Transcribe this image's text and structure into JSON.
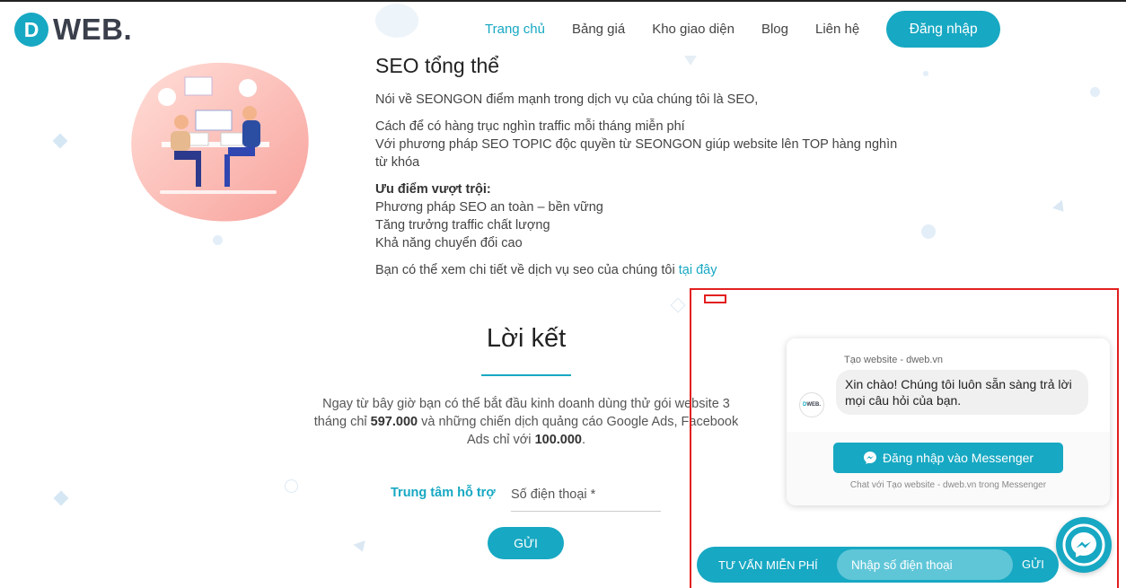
{
  "header": {
    "logo_letter": "D",
    "logo_text": "WEB.",
    "nav": [
      {
        "label": "Trang chủ",
        "active": true
      },
      {
        "label": "Bảng giá"
      },
      {
        "label": "Kho giao diện"
      },
      {
        "label": "Blog"
      },
      {
        "label": "Liên hệ"
      }
    ],
    "login_label": "Đăng nhập"
  },
  "seo": {
    "title": "SEO tổng thể",
    "intro": "Nói về SEONGON điểm mạnh trong dịch vụ của chúng tôi là SEO,",
    "line1": "Cách để có hàng trục nghìn traffic mỗi tháng miễn phí",
    "line2": "Với phương pháp SEO TOPIC độc quyền từ SEONGON giúp website lên TOP hàng nghìn từ khóa",
    "advantages_title": "Ưu điểm vượt trội:",
    "advantages": [
      "Phương pháp SEO an toàn – bền vững",
      "Tăng trưởng traffic chất lượng",
      "Khả năng chuyển đổi cao"
    ],
    "detail_text": "Bạn có thể xem chi tiết về dịch vụ seo của chúng tôi ",
    "detail_link": "tại đây"
  },
  "closing": {
    "title": "Lời kết",
    "text_a": "Ngay từ bây giờ bạn có thể bắt đầu kinh doanh dùng thử gói website 3 tháng chỉ ",
    "price1": "597.000",
    "text_b": " và những chiến dịch quảng cáo Google Ads, Facebook Ads chỉ với ",
    "price2": "100.000",
    "text_c": ".",
    "support_label": "Trung tâm hỗ trợ",
    "phone_placeholder": "Số điện thoại *",
    "send_label": "GỬI"
  },
  "chat": {
    "sender": "Tạo website - dweb.vn",
    "avatar_text": "D",
    "avatar_text2": "WEB.",
    "message": "Xin chào! Chúng tôi luôn sẵn sàng trả lời mọi câu hỏi của bạn.",
    "messenger_button": "Đăng nhập vào Messenger",
    "footer": "Chat với Tạo website - dweb.vn trong Messenger"
  },
  "consult": {
    "label": "TƯ VẤN MIỄN PHÍ",
    "placeholder": "Nhập số điện thoại",
    "send": "GỬI"
  },
  "colors": {
    "accent": "#17a8c3",
    "highlight": "#e21f1f"
  }
}
